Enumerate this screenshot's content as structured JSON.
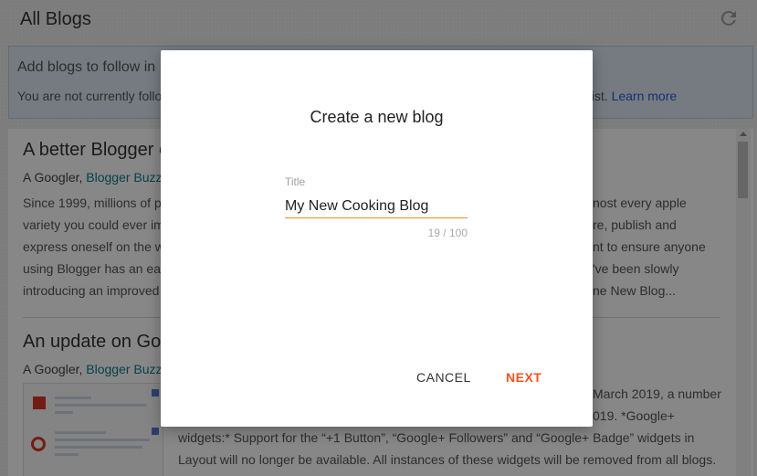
{
  "header": {
    "title": "All Blogs",
    "refresh_icon": "refresh-icon"
  },
  "info": {
    "headline": "Add blogs to follow in",
    "desc_start": "You are not currently follo",
    "desc_end": "List.",
    "learn_more": "Learn more"
  },
  "posts": [
    {
      "title": "A better Blogger e",
      "author": "A Googler,",
      "source": "Blogger Buzz",
      "lines_left": [
        "Since 1999, millions of p",
        "variety you could ever im",
        "express oneself on the w",
        "using Blogger has an eas",
        "introducing an improved"
      ],
      "lines_right": [
        "nost every apple",
        "re, publish and",
        "nt to ensure anyone",
        "'ve been slowly",
        "ne New Blog..."
      ]
    },
    {
      "title": "An update on Goo",
      "author": "A Googler,",
      "source": "Blogger Buzz",
      "lines_right": [
        "March 2019, a number",
        "019. *Google+"
      ],
      "lines_full": [
        "widgets:* Support for the “+1 Button”, “Google+ Followers” and “Google+ Badge” widgets in",
        "Layout will no longer be available. All instances of these widgets will be removed from all blogs."
      ]
    }
  ],
  "dialog": {
    "title": "Create a new blog",
    "field_label": "Title",
    "field_value": "My New Cooking Blog",
    "char_count": "19 / 100",
    "cancel_label": "CANCEL",
    "next_label": "NEXT",
    "accent_color": "#f4511e"
  }
}
